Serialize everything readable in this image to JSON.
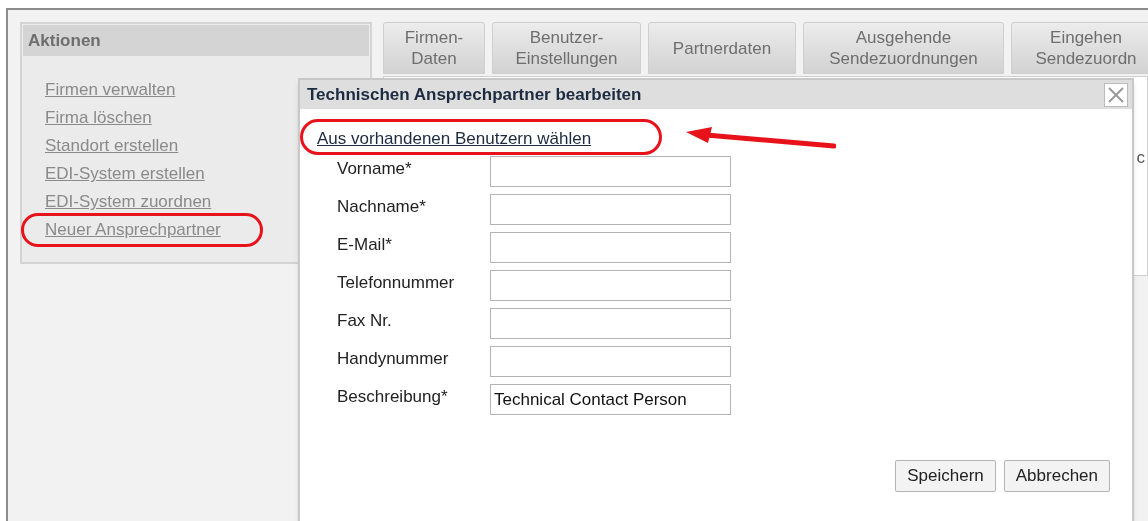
{
  "actions": {
    "title": "Aktionen",
    "items": [
      {
        "label": "Firmen verwalten",
        "highlighted": false
      },
      {
        "label": "Firma löschen",
        "highlighted": false
      },
      {
        "label": "Standort erstellen",
        "highlighted": false
      },
      {
        "label": "EDI-System erstellen",
        "highlighted": false
      },
      {
        "label": "EDI-System zuordnen",
        "highlighted": false
      },
      {
        "label": "Neuer Ansprechpartner",
        "highlighted": true
      }
    ]
  },
  "tabs": [
    {
      "lines": [
        "Firmen-",
        "Daten"
      ]
    },
    {
      "lines": [
        "Benutzer-",
        "Einstellungen"
      ]
    },
    {
      "lines": [
        "Partnerdaten"
      ]
    },
    {
      "lines": [
        "Ausgehende",
        "Sendezuordnungen"
      ]
    },
    {
      "lines": [
        "Eingehen",
        "Sendezuordn"
      ]
    }
  ],
  "background_fragment": "c",
  "dialog": {
    "title": "Technischen Ansprechpartner bearbeiten",
    "link": {
      "label": "Aus vorhandenen Benutzern wählen",
      "highlighted": true
    },
    "fields": [
      {
        "label": "Vorname*"
      },
      {
        "label": "Nachname*"
      },
      {
        "label": "E-Mail*"
      },
      {
        "label": "Telefonnummer"
      },
      {
        "label": "Fax Nr."
      },
      {
        "label": "Handynummer"
      },
      {
        "label": "Beschreibung*",
        "value": "Technical Contact Person"
      }
    ],
    "buttons": [
      "Speichern",
      "Abbrechen"
    ]
  }
}
